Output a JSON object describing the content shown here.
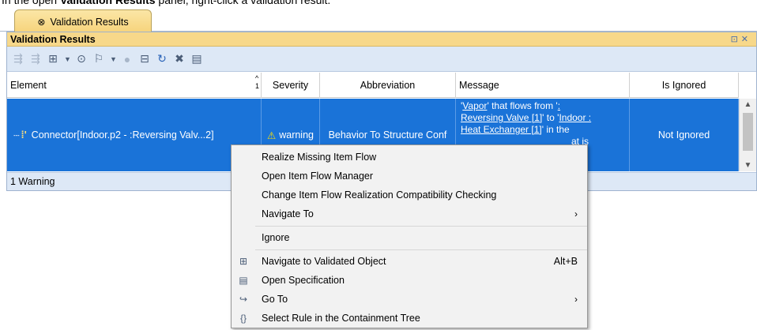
{
  "caption": {
    "prefix": "In the open ",
    "bold": "Validation Results",
    "suffix": " panel, right-click a validation result."
  },
  "tab": {
    "icon": "close-circle-icon",
    "label": "Validation Results"
  },
  "panel": {
    "title": "Validation Results",
    "controls": [
      "restore-icon",
      "close-icon"
    ]
  },
  "toolbar": {
    "icons": [
      "expand-all-icon",
      "collapse-all-icon",
      "navigate-icon",
      "dropdown-caret-icon",
      "validate-icon",
      "flag-icon",
      "dropdown-caret-icon",
      "circle-icon",
      "group-icon",
      "refresh-icon",
      "tools-icon",
      "export-icon"
    ]
  },
  "table": {
    "columns": [
      "Element",
      "Severity",
      "Abbreviation",
      "Message",
      "Is Ignored"
    ],
    "sort_indicator": "1",
    "row": {
      "element": "Connector[Indoor.p2 - :Reversing Valv...2]",
      "severity": "warning",
      "abbreviation": "Behavior To Structure Conf",
      "message": {
        "l1": [
          "'",
          "Vapor",
          "' that flows from '",
          ":"
        ],
        "l2": [
          "Reversing Valve [1]",
          "' to '",
          "Indoor :"
        ],
        "l3": [
          "Heat Exchanger [1]",
          "' in the"
        ],
        "l4": "at is"
      },
      "is_ignored": "Not Ignored"
    }
  },
  "status": "1 Warning",
  "context_menu": {
    "items": [
      {
        "label": "Realize Missing Item Flow",
        "icon": "",
        "shortcut": "",
        "submenu": false
      },
      {
        "label": "Open Item Flow Manager",
        "icon": "",
        "shortcut": "",
        "submenu": false
      },
      {
        "label": "Change Item Flow Realization Compatibility Checking",
        "icon": "",
        "shortcut": "",
        "submenu": false
      },
      {
        "label": "Navigate To",
        "icon": "",
        "shortcut": "",
        "submenu": true
      },
      {
        "label": "Ignore",
        "icon": "",
        "shortcut": "",
        "submenu": false
      },
      {
        "label": "Navigate to Validated Object",
        "icon": "navigate-tree-icon",
        "shortcut": "Alt+B",
        "submenu": false
      },
      {
        "label": "Open Specification",
        "icon": "specification-icon",
        "shortcut": "",
        "submenu": false
      },
      {
        "label": "Go To",
        "icon": "go-to-icon",
        "shortcut": "",
        "submenu": true
      },
      {
        "label": "Select Rule in the Containment Tree",
        "icon": "braces-icon",
        "shortcut": "",
        "submenu": false
      }
    ]
  },
  "colors": {
    "selection": "#1a73d8",
    "tab": "#f6d37a",
    "toolbar": "#dde8f6"
  }
}
